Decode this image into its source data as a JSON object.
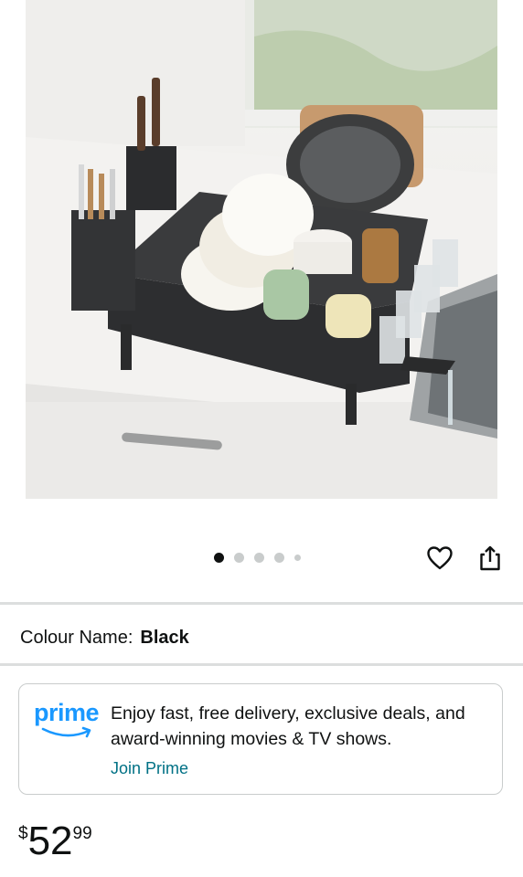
{
  "gallery": {
    "image_alt": "Black dish drying rack with plates, bowls, cups, cutlery and knife holder on a kitchen counter",
    "dots_count": 5,
    "active_dot": 0
  },
  "actions": {
    "favorite_icon": "heart-icon",
    "share_icon": "share-icon"
  },
  "variant": {
    "label": "Colour Name:",
    "value": "Black"
  },
  "prime_promo": {
    "logo_text": "prime",
    "message": "Enjoy fast, free delivery, exclusive deals, and award-winning movies & TV shows.",
    "link_label": "Join Prime",
    "brand_color": "#1a98ff",
    "link_color": "#007185"
  },
  "price": {
    "currency": "$",
    "whole": "52",
    "fraction": "99"
  }
}
